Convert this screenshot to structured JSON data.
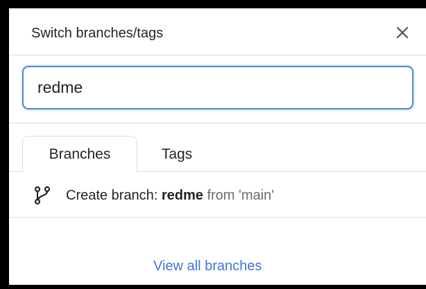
{
  "header": {
    "title": "Switch branches/tags",
    "close_icon": "close-icon"
  },
  "search": {
    "value": "redme",
    "focus_color": "#4a86d8"
  },
  "tabs": [
    {
      "label": "Branches",
      "active": true
    },
    {
      "label": "Tags",
      "active": false
    }
  ],
  "create_branch": {
    "icon": "git-branch-icon",
    "prefix": "Create branch:",
    "name": "redme",
    "from_text": "from 'main'"
  },
  "footer": {
    "link_label": "View all branches",
    "link_color": "#3b78d4"
  }
}
